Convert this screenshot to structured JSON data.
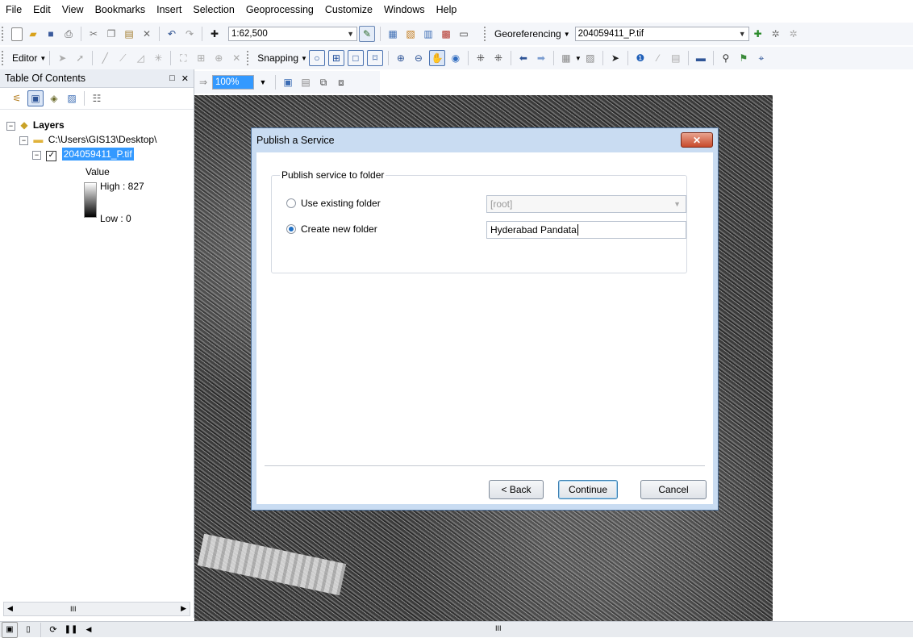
{
  "menu": [
    "File",
    "Edit",
    "View",
    "Bookmarks",
    "Insert",
    "Selection",
    "Geoprocessing",
    "Customize",
    "Windows",
    "Help"
  ],
  "toolbar": {
    "scale": "1:62,500",
    "georeferencing_label": "Georeferencing",
    "georef_layer": "204059411_P.tif",
    "editor_label": "Editor",
    "snapping_label": "Snapping",
    "zoom_value": "100%"
  },
  "toc": {
    "title": "Table Of Contents",
    "close_icon": "✕",
    "pin_icon": "□",
    "layers_label": "Layers",
    "folder_label": "C:\\Users\\GIS13\\Desktop\\",
    "raster_label": "204059411_P.tif",
    "legend_value": "Value",
    "legend_high": "High : 827",
    "legend_low": "Low : 0"
  },
  "dialog": {
    "title": "Publish a Service",
    "close_label": "✕",
    "group_title": "Publish service to folder",
    "option_existing": "Use existing folder",
    "option_new": "Create new folder",
    "existing_folder_value": "[root]",
    "new_folder_value": "Hyderabad Pandata",
    "selected_option": "new",
    "back_label": "< Back",
    "continue_label": "Continue",
    "cancel_label": "Cancel"
  },
  "status": {
    "scroll_marker": "III"
  },
  "colors": {
    "selection": "#3399ff",
    "dialog_frame": "#c9dcf2"
  }
}
